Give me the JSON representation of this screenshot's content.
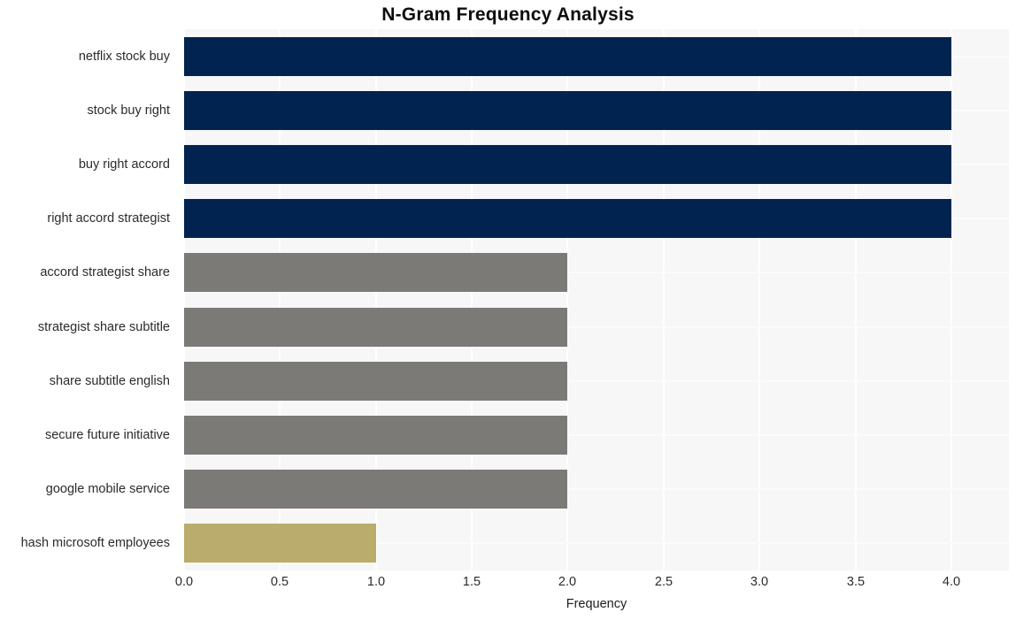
{
  "chart_data": {
    "type": "bar",
    "orientation": "horizontal",
    "title": "N-Gram Frequency Analysis",
    "xlabel": "Frequency",
    "ylabel": "",
    "categories": [
      "netflix stock buy",
      "stock buy right",
      "buy right accord",
      "right accord strategist",
      "accord strategist share",
      "strategist share subtitle",
      "share subtitle english",
      "secure future initiative",
      "google mobile service",
      "hash microsoft employees"
    ],
    "values": [
      4,
      4,
      4,
      4,
      2,
      2,
      2,
      2,
      2,
      1
    ],
    "bar_colors": [
      "#00244f",
      "#00244f",
      "#00244f",
      "#00244f",
      "#7b7a76",
      "#7b7a76",
      "#7b7a76",
      "#7b7a76",
      "#7b7a76",
      "#b9ac6c"
    ],
    "xlim": [
      0,
      4.3
    ],
    "xticks": [
      0,
      0.5,
      1,
      1.5,
      2,
      2.5,
      3,
      3.5,
      4
    ],
    "xtick_labels": [
      "0.0",
      "0.5",
      "1.0",
      "1.5",
      "2.0",
      "2.5",
      "3.0",
      "3.5",
      "4.0"
    ],
    "grid": true,
    "grid_color": "#ffffff",
    "legend": null,
    "plot_background": "#f7f7f7",
    "figure_background": "#ffffff"
  }
}
